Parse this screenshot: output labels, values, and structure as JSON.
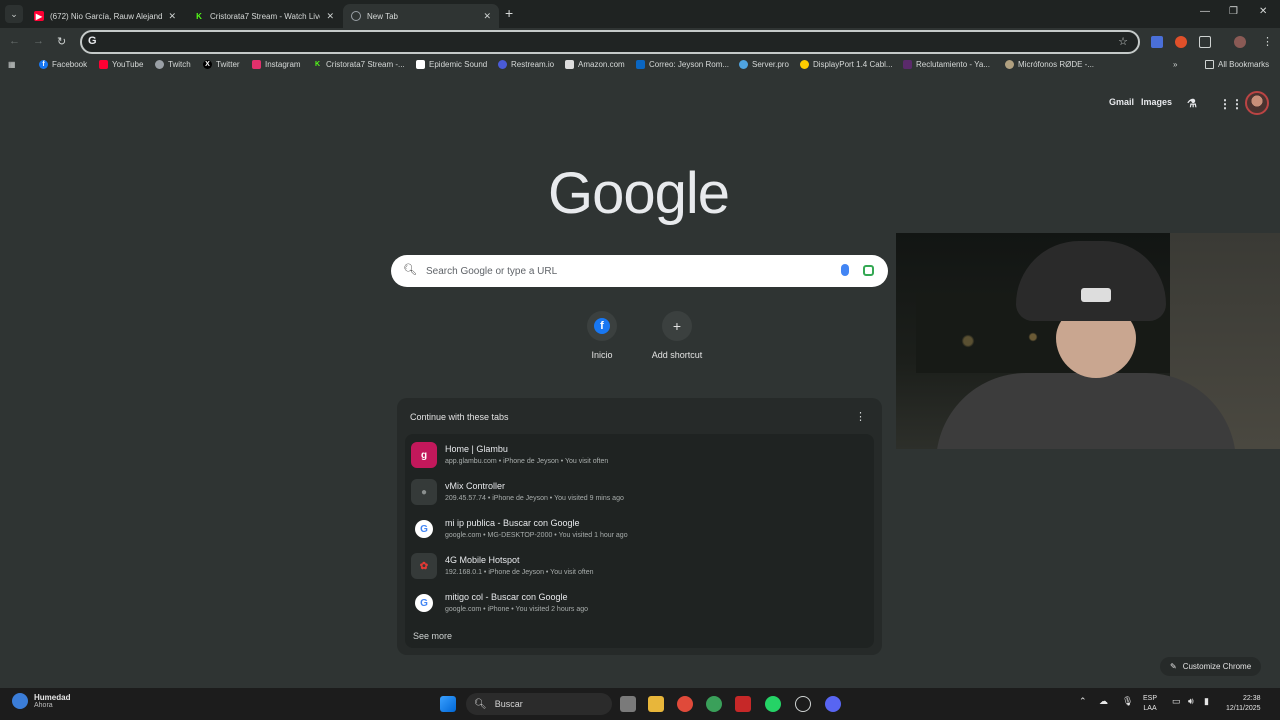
{
  "tabs": [
    {
      "title": "(672) Nio García, Rauw Alejand",
      "favicon": "youtube-icon",
      "color": "#ff0033"
    },
    {
      "title": "Cristorata7 Stream - Watch Live",
      "favicon": "kick-icon",
      "color": "#53fc18"
    },
    {
      "title": "New Tab",
      "favicon": "chrome-icon",
      "color": "#9aa0a6"
    }
  ],
  "omnibox": {
    "value": ""
  },
  "bookmarks": [
    {
      "label": "Facebook",
      "color": "#1877f2",
      "icon": "facebook-icon"
    },
    {
      "label": "YouTube",
      "color": "#ff0033",
      "icon": "youtube-icon"
    },
    {
      "label": "Twitch",
      "color": "#9aa0a6",
      "icon": "twitch-icon"
    },
    {
      "label": "Twitter",
      "color": "#000000",
      "icon": "x-icon"
    },
    {
      "label": "Instagram",
      "color": "#e1306c",
      "icon": "instagram-icon"
    },
    {
      "label": "Cristorata7 Stream -...",
      "color": "#53fc18",
      "icon": "kick-icon"
    },
    {
      "label": "Epidemic Sound",
      "color": "#ffffff",
      "icon": "epidemic-icon"
    },
    {
      "label": "Restream.io",
      "color": "#4a5bd8",
      "icon": "restream-icon"
    },
    {
      "label": "Amazon.com",
      "color": "#dddddd",
      "icon": "amazon-icon"
    },
    {
      "label": "Correo: Jeyson Rom...",
      "color": "#0a66c2",
      "icon": "outlook-icon"
    },
    {
      "label": "Server.pro",
      "color": "#4fa3e0",
      "icon": "server-icon"
    },
    {
      "label": "DisplayPort 1.4 Cabl...",
      "color": "#ffcc00",
      "icon": "globe-icon"
    },
    {
      "label": "Reclutamiento - Ya...",
      "color": "#5a2a6a",
      "icon": "page-icon"
    },
    {
      "label": "Micrófonos RØDE -...",
      "color": "#b0a080",
      "icon": "rode-icon"
    }
  ],
  "all_bookmarks": "All Bookmarks",
  "header": {
    "gmail": "Gmail",
    "images": "Images"
  },
  "logo": "Google",
  "search": {
    "placeholder": "Search Google or type a URL"
  },
  "shortcuts": [
    {
      "label": "Inicio",
      "glyph": "f"
    },
    {
      "label": "Add shortcut",
      "glyph": "+"
    }
  ],
  "continue": {
    "title": "Continue with these tabs",
    "items": [
      {
        "title": "Home | Glambu",
        "subtitle": "app.glambu.com • iPhone de Jeyson • You visit often",
        "glyph": "g",
        "color": "#c2185b"
      },
      {
        "title": "vMix Controller",
        "subtitle": "209.45.57.74 • iPhone de Jeyson • You visited 9 mins ago",
        "glyph": "●",
        "color": "#8a8f8e"
      },
      {
        "title": "mi ip publica - Buscar con Google",
        "subtitle": "google.com • MG-DESKTOP-2000 • You visited 1 hour ago",
        "glyph": "G",
        "color": "#4285f4"
      },
      {
        "title": "4G Mobile Hotspot",
        "subtitle": "192.168.0.1 • iPhone de Jeyson • You visit often",
        "glyph": "✿",
        "color": "#e53935"
      },
      {
        "title": "mitigo col - Buscar con Google",
        "subtitle": "google.com • iPhone • You visited 2 hours ago",
        "glyph": "G",
        "color": "#4285f4"
      }
    ],
    "see_more": "See more"
  },
  "customize": "Customize Chrome",
  "taskbar": {
    "weather_title": "Humedad",
    "weather_sub": "Ahora",
    "search_label": "Buscar",
    "lang1": "ESP",
    "lang2": "LAA",
    "time": "22:38",
    "date": "12/11/2025"
  }
}
